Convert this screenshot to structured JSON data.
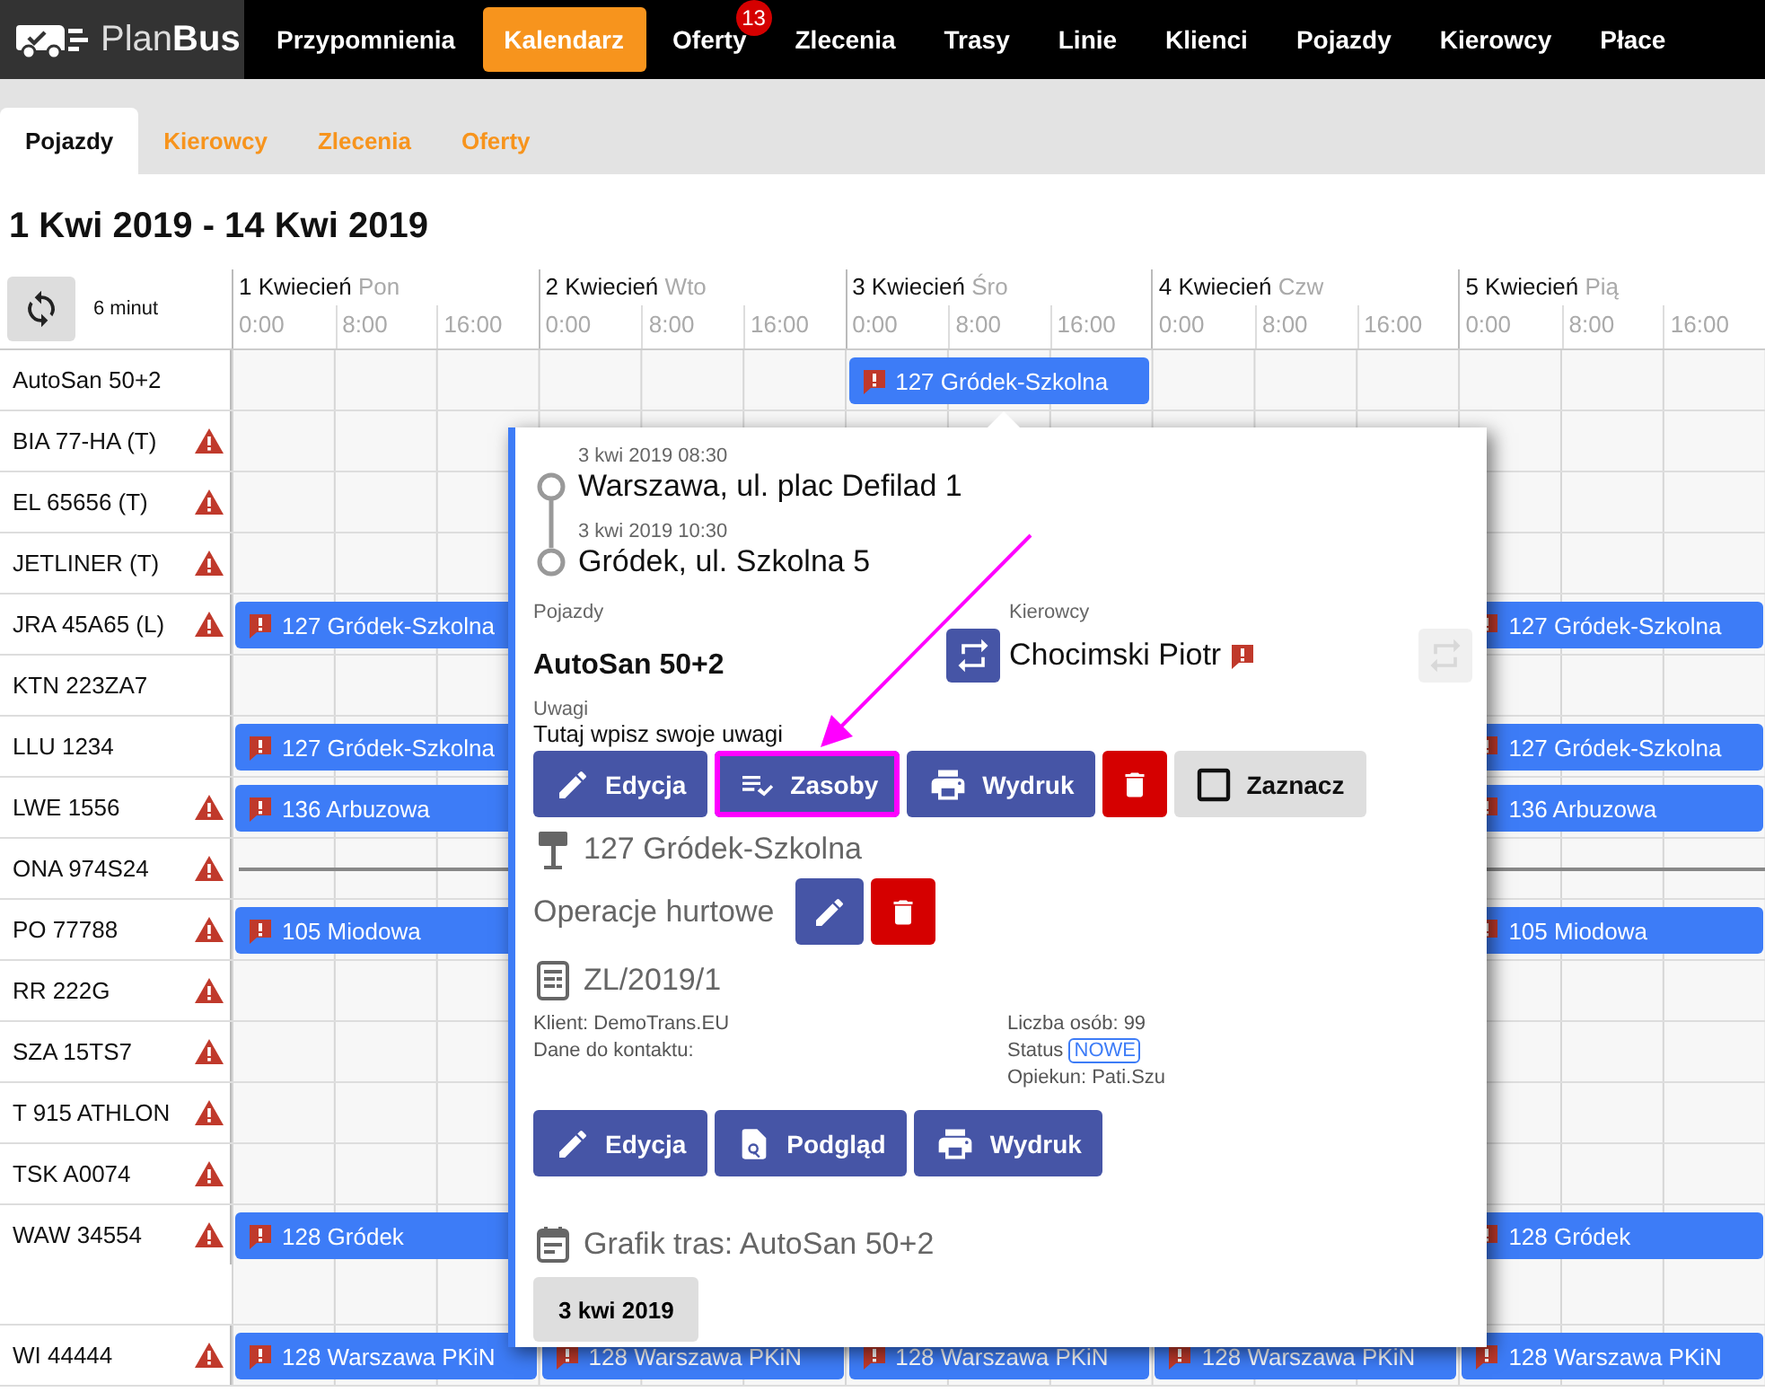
{
  "nav": {
    "logo": "Plan**Bus**",
    "items": [
      {
        "label": "Przypomnienia",
        "selected": false
      },
      {
        "label": "Kalendarz",
        "selected": true
      },
      {
        "label": "Oferty",
        "selected": false,
        "badge": "13"
      },
      {
        "label": "Zlecenia",
        "selected": false
      },
      {
        "label": "Trasy",
        "selected": false
      },
      {
        "label": "Linie",
        "selected": false
      },
      {
        "label": "Klienci",
        "selected": false
      },
      {
        "label": "Pojazdy",
        "selected": false
      },
      {
        "label": "Kierowcy",
        "selected": false
      },
      {
        "label": "Płace",
        "selected": false
      }
    ]
  },
  "subtabs": [
    {
      "label": "Pojazdy",
      "selected": true
    },
    {
      "label": "Kierowcy",
      "selected": false
    },
    {
      "label": "Zlecenia",
      "selected": false
    },
    {
      "label": "Oferty",
      "selected": false
    }
  ],
  "title": "1 Kwi 2019 - 14 Kwi 2019",
  "calendar": {
    "refresh_note": "6 minut",
    "days": [
      {
        "date": "1 Kwiecień",
        "weekday": "Pon",
        "hours": [
          "0:00",
          "8:00",
          "16:00"
        ]
      },
      {
        "date": "2 Kwiecień",
        "weekday": "Wto",
        "hours": [
          "0:00",
          "8:00",
          "16:00"
        ]
      },
      {
        "date": "3 Kwiecień",
        "weekday": "Śro",
        "hours": [
          "0:00",
          "8:00",
          "16:00"
        ]
      },
      {
        "date": "4 Kwiecień",
        "weekday": "Czw",
        "hours": [
          "0:00",
          "8:00",
          "16:00"
        ]
      },
      {
        "date": "5 Kwiecień",
        "weekday": "Pią",
        "hours": [
          "0:00",
          "8:00",
          "16:00"
        ]
      }
    ],
    "rows": [
      {
        "vehicle": "AutoSan 50+2",
        "warning": false,
        "lanes": [
          [
            {
              "kind": "empty"
            },
            {
              "kind": "empty"
            },
            {
              "kind": "event",
              "label": "127 Gródek-Szkolna",
              "alert": true
            },
            {
              "kind": "empty"
            },
            {
              "kind": "empty"
            }
          ]
        ]
      },
      {
        "vehicle": "BIA 77-HA (T)",
        "warning": true,
        "lanes": [
          [
            {
              "kind": "empty"
            },
            {
              "kind": "empty"
            },
            {
              "kind": "empty"
            },
            {
              "kind": "empty"
            },
            {
              "kind": "empty"
            }
          ]
        ]
      },
      {
        "vehicle": "EL 65656 (T)",
        "warning": true,
        "lanes": [
          [
            {
              "kind": "empty"
            },
            {
              "kind": "empty"
            },
            {
              "kind": "empty"
            },
            {
              "kind": "empty"
            },
            {
              "kind": "empty"
            }
          ]
        ]
      },
      {
        "vehicle": "JETLINER (T)",
        "warning": true,
        "lanes": [
          [
            {
              "kind": "empty"
            },
            {
              "kind": "empty"
            },
            {
              "kind": "empty"
            },
            {
              "kind": "empty"
            },
            {
              "kind": "empty"
            }
          ]
        ]
      },
      {
        "vehicle": "JRA 45A65 (L)",
        "warning": true,
        "lanes": [
          [
            {
              "kind": "event",
              "label": "127 Gródek-Szkolna",
              "alert": true
            },
            {
              "kind": "empty"
            },
            {
              "kind": "empty"
            },
            {
              "kind": "empty"
            },
            {
              "kind": "event",
              "label": "127 Gródek-Szkolna",
              "alert": true
            }
          ]
        ]
      },
      {
        "vehicle": "KTN 223ZA7",
        "warning": false,
        "lanes": [
          [
            {
              "kind": "empty"
            },
            {
              "kind": "empty"
            },
            {
              "kind": "empty"
            },
            {
              "kind": "empty"
            },
            {
              "kind": "empty"
            }
          ]
        ]
      },
      {
        "vehicle": "LLU 1234",
        "warning": false,
        "lanes": [
          [
            {
              "kind": "event",
              "label": "127 Gródek-Szkolna",
              "alert": true
            },
            {
              "kind": "empty"
            },
            {
              "kind": "empty"
            },
            {
              "kind": "empty"
            },
            {
              "kind": "event",
              "label": "127 Gródek-Szkolna",
              "alert": true
            }
          ]
        ]
      },
      {
        "vehicle": "LWE 1556",
        "warning": true,
        "lanes": [
          [
            {
              "kind": "event",
              "label": "136 Arbuzowa",
              "alert": true
            },
            {
              "kind": "empty"
            },
            {
              "kind": "empty"
            },
            {
              "kind": "empty"
            },
            {
              "kind": "event",
              "label": "136 Arbuzowa",
              "alert": true
            }
          ]
        ]
      },
      {
        "vehicle": "ONA 974S24",
        "warning": true,
        "lanes": [
          [
            {
              "kind": "line"
            },
            {
              "kind": "line"
            },
            {
              "kind": "line"
            },
            {
              "kind": "line"
            },
            {
              "kind": "line"
            }
          ]
        ]
      },
      {
        "vehicle": "PO 77788",
        "warning": true,
        "lanes": [
          [
            {
              "kind": "event",
              "label": "105 Miodowa",
              "alert": true
            },
            {
              "kind": "empty"
            },
            {
              "kind": "empty"
            },
            {
              "kind": "empty"
            },
            {
              "kind": "event",
              "label": "105 Miodowa",
              "alert": true
            }
          ]
        ]
      },
      {
        "vehicle": "RR 222G",
        "warning": true,
        "lanes": [
          [
            {
              "kind": "empty"
            },
            {
              "kind": "empty"
            },
            {
              "kind": "empty"
            },
            {
              "kind": "empty"
            },
            {
              "kind": "empty"
            }
          ]
        ]
      },
      {
        "vehicle": "SZA 15TS7",
        "warning": true,
        "lanes": [
          [
            {
              "kind": "empty"
            },
            {
              "kind": "empty"
            },
            {
              "kind": "empty"
            },
            {
              "kind": "empty"
            },
            {
              "kind": "empty"
            }
          ]
        ]
      },
      {
        "vehicle": "T 915 ATHLON",
        "warning": true,
        "lanes": [
          [
            {
              "kind": "empty"
            },
            {
              "kind": "empty"
            },
            {
              "kind": "empty"
            },
            {
              "kind": "empty"
            },
            {
              "kind": "empty"
            }
          ]
        ]
      },
      {
        "vehicle": "TSK A0074",
        "warning": true,
        "lanes": [
          [
            {
              "kind": "empty"
            },
            {
              "kind": "empty"
            },
            {
              "kind": "empty"
            },
            {
              "kind": "empty"
            },
            {
              "kind": "empty"
            }
          ]
        ]
      },
      {
        "vehicle": "WAW 34554",
        "warning": true,
        "lanes": [
          [
            {
              "kind": "event",
              "label": "128 Gródek",
              "alert": true
            },
            {
              "kind": "empty"
            },
            {
              "kind": "empty"
            },
            {
              "kind": "empty"
            },
            {
              "kind": "event",
              "label": "128 Gródek",
              "alert": true
            }
          ],
          [
            {
              "kind": "empty"
            },
            {
              "kind": "empty"
            },
            {
              "kind": "empty"
            },
            {
              "kind": "empty"
            },
            {
              "kind": "empty"
            }
          ]
        ]
      },
      {
        "vehicle": "WI 44444",
        "warning": true,
        "lanes": [
          [
            {
              "kind": "event",
              "label": "128 Warszawa PKiN",
              "alert": true
            },
            {
              "kind": "event",
              "label": "128 Warszawa PKiN",
              "alert": true
            },
            {
              "kind": "event",
              "label": "128 Warszawa PKiN",
              "alert": true
            },
            {
              "kind": "event",
              "label": "128 Warszawa PKiN",
              "alert": true
            },
            {
              "kind": "event",
              "label": "128 Warszawa PKiN",
              "alert": true
            }
          ]
        ]
      }
    ]
  },
  "popup": {
    "stops": [
      {
        "time": "3 kwi 2019 08:30",
        "place": "Warszawa, ul. plac Defilad 1"
      },
      {
        "time": "3 kwi 2019 10:30",
        "place": "Gródek, ul. Szkolna 5"
      }
    ],
    "vehicle_label": "Pojazdy",
    "vehicle": "AutoSan 50+2",
    "driver_label": "Kierowcy",
    "driver": "Chocimski Piotr",
    "driver_alert": true,
    "swap_buttons": [
      {
        "disabled": false
      },
      {
        "disabled": true
      }
    ],
    "notes_label": "Uwagi",
    "notes": "Tutaj wpisz swoje uwagi",
    "actions": [
      {
        "kind": "edit",
        "label": "Edycja",
        "highlighted": false
      },
      {
        "kind": "resources",
        "label": "Zasoby",
        "highlighted": true
      },
      {
        "kind": "print",
        "label": "Wydruk",
        "highlighted": false
      },
      {
        "kind": "delete",
        "highlighted": false
      },
      {
        "kind": "select",
        "label": "Zaznacz",
        "checked": false,
        "highlighted": false
      }
    ],
    "route": "127 Gródek-Szkolna",
    "bulk_label": "Operacje hurtowe",
    "bulk_actions": [
      {
        "kind": "edit",
        "highlighted": false
      },
      {
        "kind": "delete",
        "highlighted": false
      }
    ],
    "order": {
      "number": "ZL/2019/1",
      "client": "Klient: DemoTrans.EU",
      "contact": "Dane do kontaktu:",
      "people": "Liczba osób: 99",
      "status_label": "Status",
      "status": "NOWE",
      "keeper": "Opiekun: Pati.Szu",
      "actions": [
        {
          "kind": "edit",
          "label": "Edycja",
          "highlighted": false
        },
        {
          "kind": "preview",
          "label": "Podgląd",
          "highlighted": false
        },
        {
          "kind": "print",
          "label": "Wydruk",
          "highlighted": false
        }
      ]
    },
    "schedule": {
      "title": "Grafik tras: AutoSan 50+2",
      "dates": [
        "3 kwi 2019"
      ]
    }
  }
}
